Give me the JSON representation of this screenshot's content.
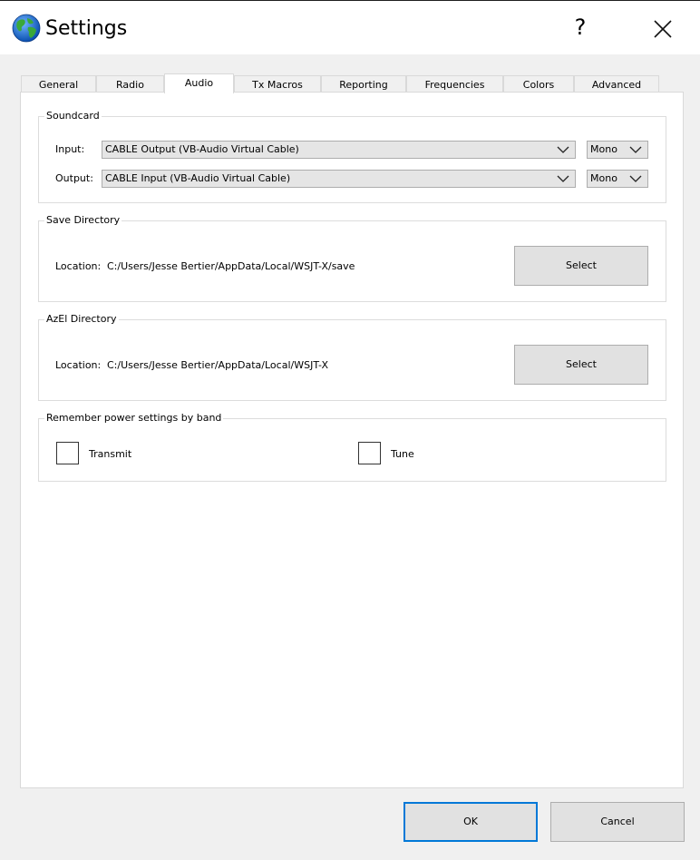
{
  "window": {
    "title": "Settings",
    "help_symbol": "?",
    "app_icon": "globe-icon",
    "close_icon": "close-icon"
  },
  "tabs": [
    {
      "label": "General"
    },
    {
      "label": "Radio"
    },
    {
      "label": "Audio"
    },
    {
      "label": "Tx Macros"
    },
    {
      "label": "Reporting"
    },
    {
      "label": "Frequencies"
    },
    {
      "label": "Colors"
    },
    {
      "label": "Advanced"
    }
  ],
  "active_tab": "Audio",
  "soundcard": {
    "title": "Soundcard",
    "input_label": "Input:",
    "input_device": "CABLE Output (VB-Audio Virtual Cable)",
    "input_channel": "Mono",
    "output_label": "Output:",
    "output_device": "CABLE Input (VB-Audio Virtual Cable)",
    "output_channel": "Mono"
  },
  "save_directory": {
    "title": "Save Directory",
    "location_label": "Location:",
    "path": "C:/Users/Jesse Bertier/AppData/Local/WSJT-X/save",
    "button": "Select"
  },
  "azel_directory": {
    "title": "AzEl Directory",
    "location_label": "Location:",
    "path": "C:/Users/Jesse Bertier/AppData/Local/WSJT-X",
    "button": "Select"
  },
  "power_settings": {
    "title": "Remember power settings by band",
    "transmit_label": "Transmit",
    "transmit_checked": false,
    "tune_label": "Tune",
    "tune_checked": false
  },
  "footer": {
    "ok": "OK",
    "cancel": "Cancel"
  },
  "colors": {
    "focus_border": "#0078d7",
    "button_bg": "#e1e1e1",
    "window_bg": "#f0f0f0"
  }
}
